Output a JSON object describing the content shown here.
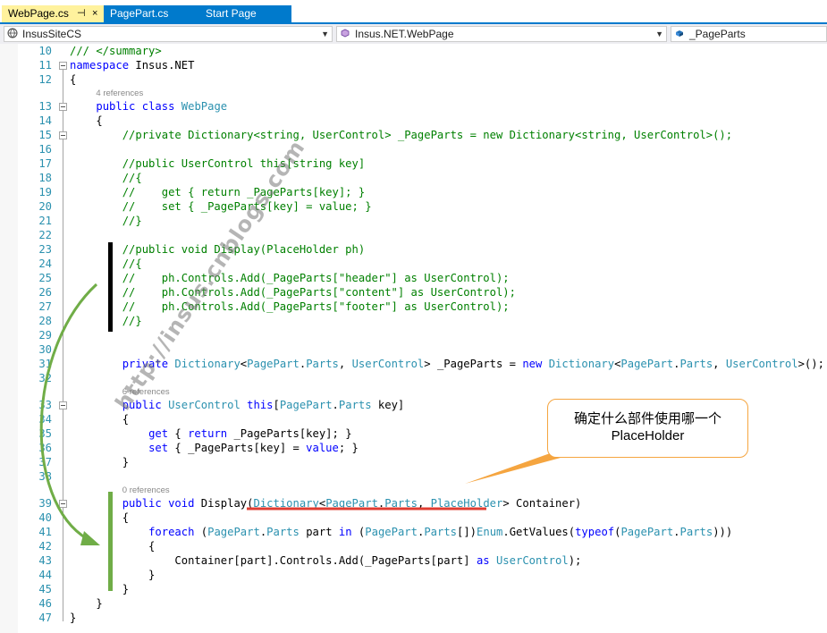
{
  "tabs": [
    {
      "label": "WebPage.cs",
      "pin": "⊣",
      "close": "×"
    },
    {
      "label": "PagePart.cs"
    },
    {
      "label": "Start Page"
    }
  ],
  "nav": {
    "project": "InsusSiteCS",
    "type": "Insus.NET.WebPage",
    "member": "_PageParts"
  },
  "code": {
    "lines": [
      {
        "n": "10",
        "html": "<span class='cm'>/// &lt;/summary&gt;</span>"
      },
      {
        "n": "11",
        "html": "<span class='kw'>namespace</span> Insus.NET"
      },
      {
        "n": "12",
        "html": "{"
      },
      {
        "n": "13",
        "html": "    <span class='kw'>public</span> <span class='kw'>class</span> <span class='ty'>WebPage</span>"
      },
      {
        "n": "14",
        "html": "    {"
      },
      {
        "n": "15",
        "html": "        <span class='cm'>//private Dictionary&lt;string, UserControl&gt; _PageParts = new Dictionary&lt;string, UserControl&gt;();</span>"
      },
      {
        "n": "16",
        "html": ""
      },
      {
        "n": "17",
        "html": "        <span class='cm'>//public UserControl this[string key]</span>"
      },
      {
        "n": "18",
        "html": "        <span class='cm'>//{</span>"
      },
      {
        "n": "19",
        "html": "        <span class='cm'>//    get { return _PageParts[key]; }</span>"
      },
      {
        "n": "20",
        "html": "        <span class='cm'>//    set { _PageParts[key] = value; }</span>"
      },
      {
        "n": "21",
        "html": "        <span class='cm'>//}</span>"
      },
      {
        "n": "22",
        "html": ""
      },
      {
        "n": "23",
        "html": "        <span class='cm'>//public void Display(PlaceHolder ph)</span>"
      },
      {
        "n": "24",
        "html": "        <span class='cm'>//{</span>"
      },
      {
        "n": "25",
        "html": "        <span class='cm'>//    ph.Controls.Add(_PageParts[\"header\"] as UserControl);</span>"
      },
      {
        "n": "26",
        "html": "        <span class='cm'>//    ph.Controls.Add(_PageParts[\"content\"] as UserControl);</span>"
      },
      {
        "n": "27",
        "html": "        <span class='cm'>//    ph.Controls.Add(_PageParts[\"footer\"] as UserControl);</span>"
      },
      {
        "n": "28",
        "html": "        <span class='cm'>//}</span>"
      },
      {
        "n": "29",
        "html": ""
      },
      {
        "n": "30",
        "html": ""
      },
      {
        "n": "31",
        "html": "        <span class='kw'>private</span> <span class='ty'>Dictionary</span>&lt;<span class='ty'>PagePart</span>.<span class='ty'>Parts</span>, <span class='ty'>UserControl</span>&gt; _PageParts = <span class='kw'>new</span> <span class='ty'>Dictionary</span>&lt;<span class='ty'>PagePart</span>.<span class='ty'>Parts</span>, <span class='ty'>UserControl</span>&gt;();"
      },
      {
        "n": "32",
        "html": ""
      },
      {
        "n": "33",
        "html": "        <span class='kw'>public</span> <span class='ty'>UserControl</span> <span class='kw'>this</span>[<span class='ty'>PagePart</span>.<span class='ty'>Parts</span> key]"
      },
      {
        "n": "34",
        "html": "        {"
      },
      {
        "n": "35",
        "html": "            <span class='kw'>get</span> { <span class='kw'>return</span> _PageParts[key]; }"
      },
      {
        "n": "36",
        "html": "            <span class='kw'>set</span> { _PageParts[key] = <span class='kw'>value</span>; }"
      },
      {
        "n": "37",
        "html": "        }"
      },
      {
        "n": "38",
        "html": ""
      },
      {
        "n": "39",
        "html": "        <span class='kw'>public</span> <span class='kw'>void</span> Display(<span class='ty'>Dictionary</span>&lt;<span class='ty'>PagePart</span>.<span class='ty'>Parts</span>, <span class='ty'>PlaceHolder</span>&gt; Container)"
      },
      {
        "n": "40",
        "html": "        {"
      },
      {
        "n": "41",
        "html": "            <span class='kw'>foreach</span> (<span class='ty'>PagePart</span>.<span class='ty'>Parts</span> part <span class='kw'>in</span> (<span class='ty'>PagePart</span>.<span class='ty'>Parts</span>[])<span class='ty'>Enum</span>.GetValues(<span class='kw'>typeof</span>(<span class='ty'>PagePart</span>.<span class='ty'>Parts</span>)))"
      },
      {
        "n": "42",
        "html": "            {"
      },
      {
        "n": "43",
        "html": "                Container[part].Controls.Add(_PageParts[part] <span class='kw'>as</span> <span class='ty'>UserControl</span>);"
      },
      {
        "n": "44",
        "html": "            }"
      },
      {
        "n": "45",
        "html": "        }"
      },
      {
        "n": "46",
        "html": "    }"
      },
      {
        "n": "47",
        "html": "}"
      }
    ],
    "lens": [
      {
        "after": "12",
        "text": "4 references"
      },
      {
        "after": "32",
        "text": "6 references"
      },
      {
        "after": "38",
        "text": "0 references"
      }
    ]
  },
  "callout": {
    "line1": "确定什么部件使用哪一个",
    "line2": "PlaceHolder"
  },
  "watermark": "http://insus.cnblogs.com",
  "colors": {
    "accent": "#007acc",
    "active_tab": "#fff29d",
    "arrow_green": "#70ad47",
    "callout_orange": "#f5a540",
    "underline_red": "#e03c31"
  }
}
